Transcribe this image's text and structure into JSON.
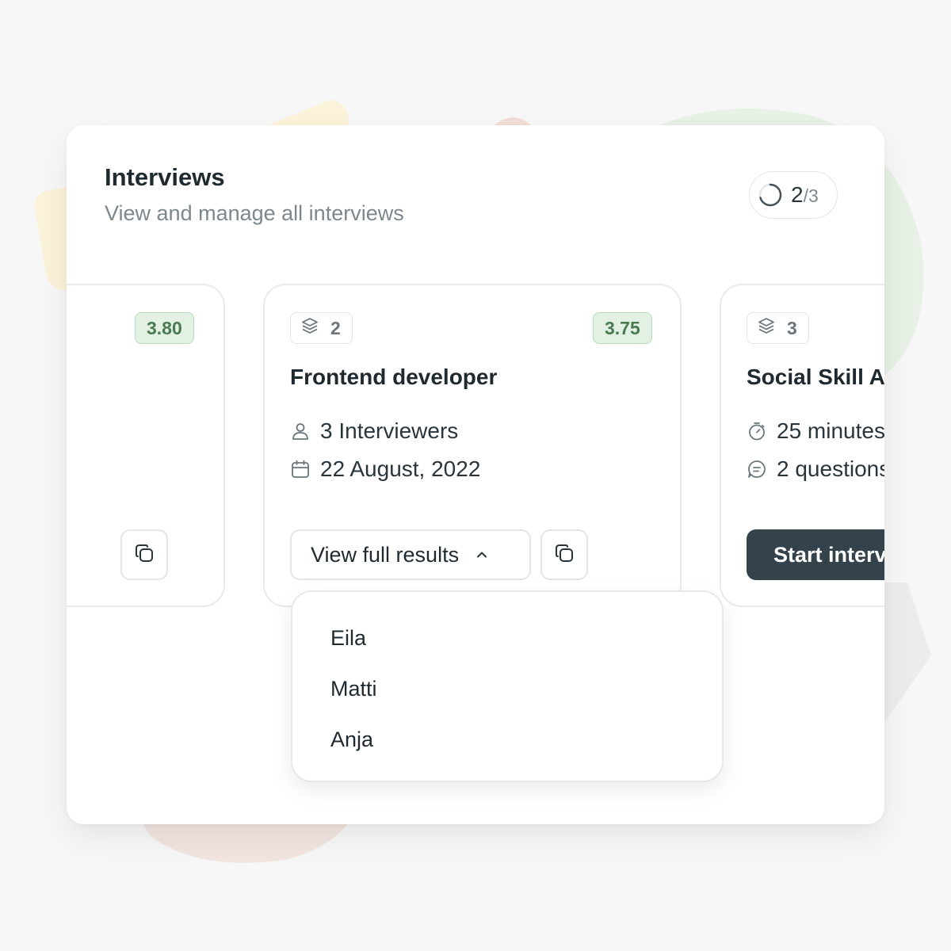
{
  "panel": {
    "title": "Interviews",
    "subtitle": "View and manage all interviews"
  },
  "pager": {
    "icon": "loading-ring-icon",
    "current": "2",
    "total": "/3"
  },
  "cards": [
    {
      "score": "3.80",
      "copy_icon": "copy-icon"
    },
    {
      "count_icon": "layers-icon",
      "count": "2",
      "score": "3.75",
      "title": "Frontend developer",
      "meta": [
        {
          "icon": "user-icon",
          "text": "3 Interviewers"
        },
        {
          "icon": "calendar-icon",
          "text": "22 August, 2022"
        }
      ],
      "results_button": "View full results",
      "results_icon": "chevron-up-icon",
      "copy_icon": "copy-icon"
    },
    {
      "count_icon": "layers-icon",
      "count": "3",
      "title": "Social Skill As",
      "meta": [
        {
          "icon": "timer-icon",
          "text": "25 minutes"
        },
        {
          "icon": "chat-icon",
          "text": "2 questions"
        }
      ],
      "start_button": "Start interv"
    }
  ],
  "dropdown": {
    "items": [
      "Eila",
      "Matti",
      "Anja"
    ]
  },
  "colors": {
    "accent_dark": "#34434b",
    "score_bg": "#e3f1e4",
    "score_text": "#4a7a52",
    "muted_text": "#7d878d"
  }
}
